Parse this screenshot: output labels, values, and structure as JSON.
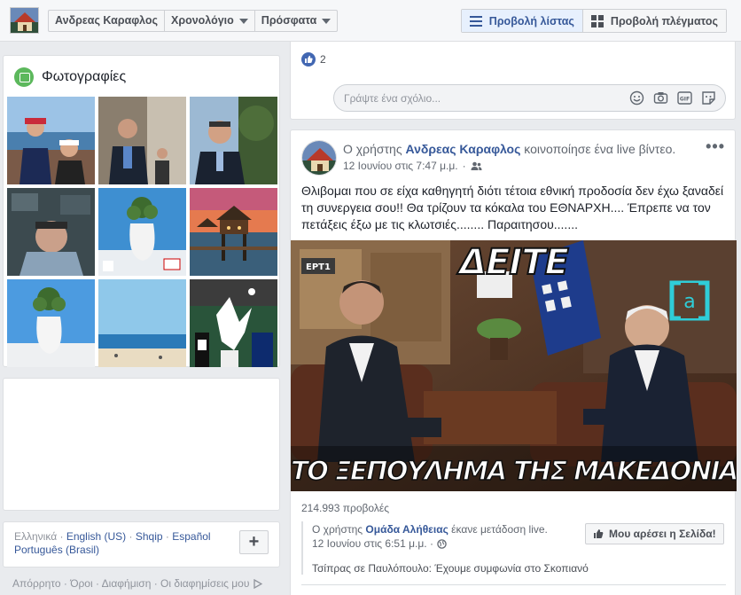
{
  "topbar": {
    "name_button": "Ανδρεας Καραφλος",
    "timeline_button": "Χρονολόγιο",
    "recent_button": "Πρόσφατα",
    "list_view": "Προβολή λίστας",
    "grid_view": "Προβολή πλέγματος"
  },
  "photos": {
    "title": "Φωτογραφίες"
  },
  "languages": {
    "current": "Ελληνικά",
    "links": [
      "English (US)",
      "Shqip",
      "Español",
      "Português (Brasil)"
    ]
  },
  "footer": {
    "links": "Απόρρητο · Όροι · Διαφήμιση · Οι διαφημίσεις μου"
  },
  "comment_section": {
    "like_count": "2",
    "comment_placeholder": "Γράψτε ένα σχόλιο..."
  },
  "post": {
    "prefix": "Ο χρήστης",
    "author": "Ανδρεας Καραφλος",
    "action": "κοινοποίησε ένα live βίντεο.",
    "timestamp": "12 Ιουνίου στις 7:47 μ.μ.",
    "text": "Θλιβομαι που σε είχα καθηγητή διότι τέτοια εθνική προδοσία δεν έχω ξαναδεί τη συνεργεια σου!! Θα τρίζουν τα κόκαλα του ΕΘΝΑΡΧΗ.... Έπρεπε να τον πετάξεις έξω με τις κλωτσιές........ Παραιτησου.......",
    "video_top_caption": "ΔΕΙΤΕ",
    "video_bottom_caption": "ΤΟ ΞΕΠΟΥΛΗΜΑ ΤΗΣ ΜΑΚΕΔΟΝΙΑΣ",
    "views": "214.993 προβολές",
    "shared": {
      "prefix": "Ο χρήστης",
      "page": "Ομάδα Αλήθειας",
      "action": "έκανε μετάδοση live.",
      "timestamp": "12 Ιουνίου στις 6:51 μ.μ. ·",
      "like_page_button": "Μου αρέσει η Σελίδα!",
      "description": "Τσίπρας σε Παυλόπουλο: Έχουμε συμφωνία στο Σκοπιανό"
    }
  },
  "colors": {
    "link_blue": "#365899",
    "facebook_blue": "#4267b2",
    "page_bg": "#e9ebee"
  }
}
